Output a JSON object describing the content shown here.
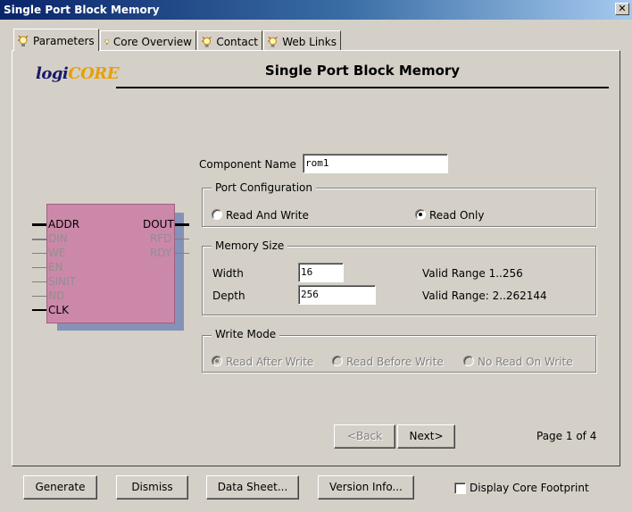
{
  "window": {
    "title": "Single Port Block Memory",
    "close_glyph": "✕"
  },
  "tabs": [
    {
      "label": "Parameters",
      "icon": "lightbulb-icon",
      "active": true
    },
    {
      "label": "Core Overview",
      "icon": "lightbulb-icon",
      "active": false
    },
    {
      "label": "Contact",
      "icon": "lightbulb-icon",
      "active": false
    },
    {
      "label": "Web Links",
      "icon": "lightbulb-icon",
      "active": false
    }
  ],
  "logo": {
    "part1": "logi",
    "part2": "CORE"
  },
  "page_title": "Single Port Block Memory",
  "component_name": {
    "label": "Component Name",
    "value": "rom1"
  },
  "port_config": {
    "legend": "Port Configuration",
    "options": [
      {
        "label": "Read And Write",
        "selected": false
      },
      {
        "label": "Read Only",
        "selected": true
      }
    ]
  },
  "memory_size": {
    "legend": "Memory Size",
    "width": {
      "label": "Width",
      "value": "16",
      "range": "Valid Range 1..256"
    },
    "depth": {
      "label": "Depth",
      "value": "256",
      "range": "Valid Range: 2..262144"
    }
  },
  "write_mode": {
    "legend": "Write Mode",
    "options": [
      {
        "label": "Read After Write",
        "selected": true
      },
      {
        "label": "Read Before Write",
        "selected": false
      },
      {
        "label": "No Read On Write",
        "selected": false
      }
    ]
  },
  "symbol": {
    "left_pins": [
      {
        "name": "ADDR",
        "enabled": true
      },
      {
        "name": "DIN",
        "enabled": false
      },
      {
        "name": "WE",
        "enabled": false
      },
      {
        "name": "EN",
        "enabled": false
      },
      {
        "name": "SINIT",
        "enabled": false
      },
      {
        "name": "ND",
        "enabled": false
      },
      {
        "name": "CLK",
        "enabled": true
      }
    ],
    "right_pins": [
      {
        "name": "DOUT",
        "enabled": true
      },
      {
        "name": "RFD",
        "enabled": false
      },
      {
        "name": "RDY",
        "enabled": false
      }
    ],
    "body_color": "#cc88a8",
    "shadow_color": "#8592b8"
  },
  "nav": {
    "back": "<Back",
    "next": "Next>",
    "page": "Page 1 of 4"
  },
  "footer": {
    "generate": "Generate",
    "dismiss": "Dismiss",
    "datasheet": "Data Sheet...",
    "version": "Version Info...",
    "footprint": "Display Core Footprint"
  },
  "colors": {
    "titlebar_start": "#0a246a",
    "titlebar_end": "#a6caf0",
    "dialog_bg": "#d4d0c8"
  }
}
